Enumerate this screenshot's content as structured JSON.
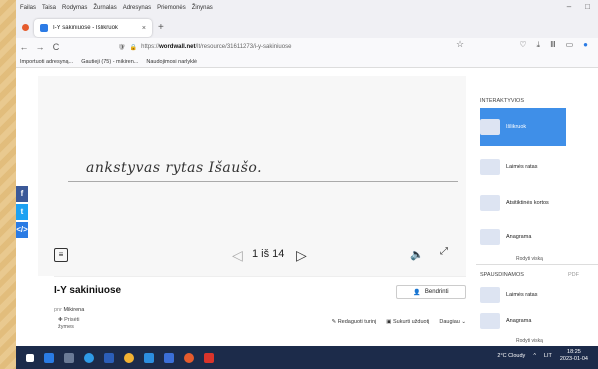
{
  "menubar": [
    "Failas",
    "Taisa",
    "Rodymas",
    "Žurnalas",
    "Adresynas",
    "Priemonės",
    "Žinynas"
  ],
  "window_controls": [
    "–",
    "□"
  ],
  "tab": {
    "title": "I-Y sakiniuose - Išlikruok",
    "close": "×",
    "new": "+"
  },
  "nav": {
    "back": "←",
    "forward": "→",
    "reload": "C",
    "url_prefix": "https://",
    "url_host": "wordwall.net",
    "url_path": "/lt/resource/31611273/i-y-sakiniuose",
    "star": "☆"
  },
  "bookmarks": [
    "Importuoti adresyną...",
    "Gautieji (75) - mikiren...",
    "Naudojimosi narlyklė"
  ],
  "activity": {
    "sentence": "ankstyvas rytas Išaušo.",
    "page_count": "1 iš 14"
  },
  "share": {
    "facebook": "f",
    "twitter": "t",
    "embed": "</>"
  },
  "resource": {
    "title": "I-Y sakiniuose",
    "author_prefix": "pnr",
    "author": "Mikirena",
    "like": "Prisėti",
    "like2": "žymes",
    "share_button": "Bendrinti",
    "actions": [
      "Redaguoti turinį",
      "Sukurti užduotį",
      "Daugiau"
    ]
  },
  "panel": {
    "interactive_heading": "INTERAKTYVIOS",
    "interactive_items": [
      "Išlikruok",
      "Laimės ratas",
      "Atsitiktinės kortos",
      "Anagrama"
    ],
    "show_all": "Rodyti viską",
    "print_heading": "SPAUSDINAMOS",
    "print_tag": "PDF",
    "print_items": [
      "Laimės ratas",
      "Anagrama"
    ],
    "show_all2": "Rodyti viską"
  },
  "taskbar": {
    "weather": "2°C  Cloudy",
    "lang": "LIT",
    "time": "18:25",
    "date": "2023-01-04"
  },
  "colors": {
    "accent": "#3f8fe8",
    "facebook": "#3b5998",
    "twitter": "#1da1f2",
    "embed": "#2a7be4",
    "taskbar": "#1c2b4a"
  }
}
